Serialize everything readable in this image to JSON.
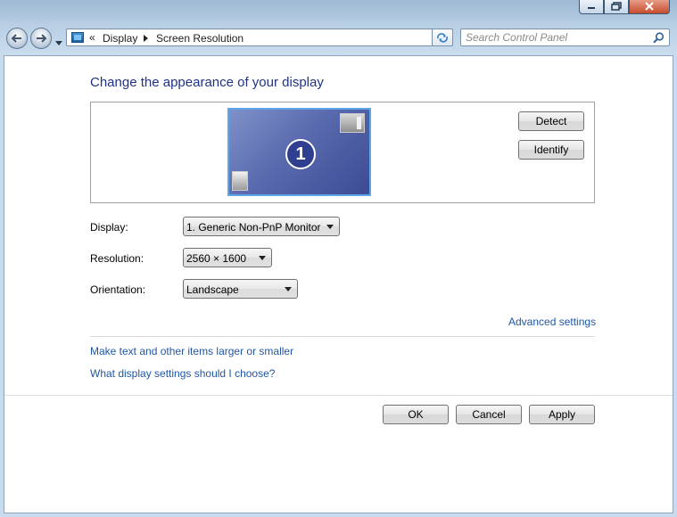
{
  "address_bar": {
    "chevron": "«",
    "crumbs": [
      "Display",
      "Screen Resolution"
    ]
  },
  "search": {
    "placeholder": "Search Control Panel"
  },
  "page": {
    "title": "Change the appearance of your display",
    "monitor_number": "1",
    "detect_label": "Detect",
    "identify_label": "Identify"
  },
  "settings": {
    "display_label": "Display:",
    "display_value": "1. Generic Non-PnP Monitor",
    "resolution_label": "Resolution:",
    "resolution_value": "2560 × 1600",
    "orientation_label": "Orientation:",
    "orientation_value": "Landscape"
  },
  "links": {
    "advanced": "Advanced settings",
    "text_size": "Make text and other items larger or smaller",
    "which_settings": "What display settings should I choose?"
  },
  "footer": {
    "ok_label": "OK",
    "cancel_label": "Cancel",
    "apply_label": "Apply"
  },
  "colors": {
    "heading": "#1e3287",
    "link": "#1f57a4",
    "monitor_border": "#5fa6e8",
    "monitor_fill": "#5a6aae"
  }
}
